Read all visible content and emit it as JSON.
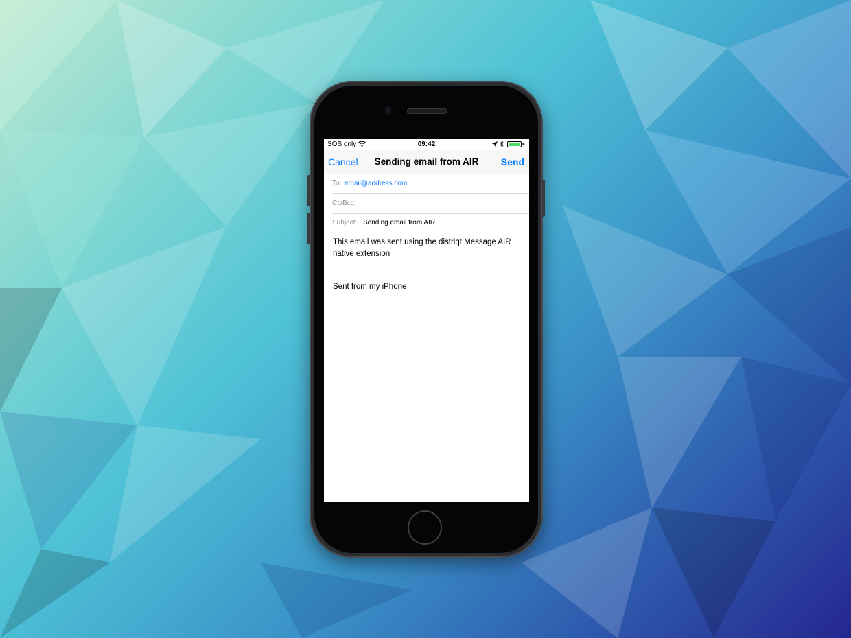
{
  "status_bar": {
    "carrier": "SOS only",
    "time": "09:42",
    "icons": [
      "wifi-icon",
      "location-arrow-icon",
      "bluetooth-icon",
      "battery-charging-icon"
    ]
  },
  "nav": {
    "cancel_label": "Cancel",
    "title": "Sending email from AIR",
    "send_label": "Send"
  },
  "compose": {
    "to_label": "To:",
    "to_value": "email@address.com",
    "ccbcc_label": "Cc/Bcc:",
    "ccbcc_value": "",
    "subject_label": "Subject:",
    "subject_value": "Sending email from AIR",
    "body": "This email was sent using the distriqt Message AIR native extension",
    "signature": "Sent from my iPhone"
  },
  "colors": {
    "accent": "#0a7bff",
    "battery": "#4cd964",
    "phone_body": "#2b2c2f"
  }
}
